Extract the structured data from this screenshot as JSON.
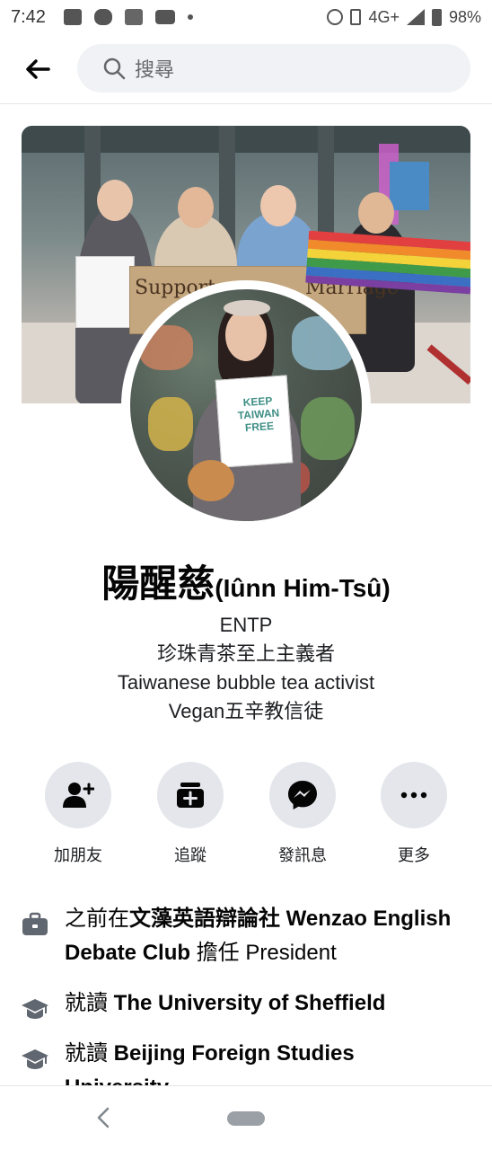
{
  "status_bar": {
    "time": "7:42",
    "network": "4G+",
    "battery": "98%"
  },
  "search": {
    "placeholder": "搜尋"
  },
  "profile": {
    "name": "陽醒慈",
    "name_romanized": "(Iûnn Him-Tsû)",
    "bio": [
      "ENTP",
      "珍珠青茶至上主義者",
      "Taiwanese bubble tea activist",
      "Vegan五辛教信徒"
    ],
    "cover_sign_text": "Support",
    "cover_sign_text2": "Marriage",
    "avatar_sign_text": "KEEP TAIWAN FREE"
  },
  "actions": [
    {
      "label": "加朋友",
      "icon": "add-friend-icon"
    },
    {
      "label": "追蹤",
      "icon": "follow-icon"
    },
    {
      "label": "發訊息",
      "icon": "messenger-icon"
    },
    {
      "label": "更多",
      "icon": "more-icon"
    }
  ],
  "intro": [
    {
      "icon": "briefcase-icon",
      "prefix": "之前在",
      "bold": "文藻英語辯論社 Wenzao English Debate Club",
      "suffix": " 擔任 President"
    },
    {
      "icon": "graduation-cap-icon",
      "prefix": "就讀 ",
      "bold": "The University of Sheffield",
      "suffix": ""
    },
    {
      "icon": "graduation-cap-icon",
      "prefix": "就讀 ",
      "bold": "Beijing Foreign Studies University",
      "suffix": ""
    }
  ],
  "colors": {
    "accent": "#1877f2",
    "action_circle": "#e4e6eb",
    "search_bg": "#f0f2f5",
    "text_secondary": "#65676b"
  }
}
